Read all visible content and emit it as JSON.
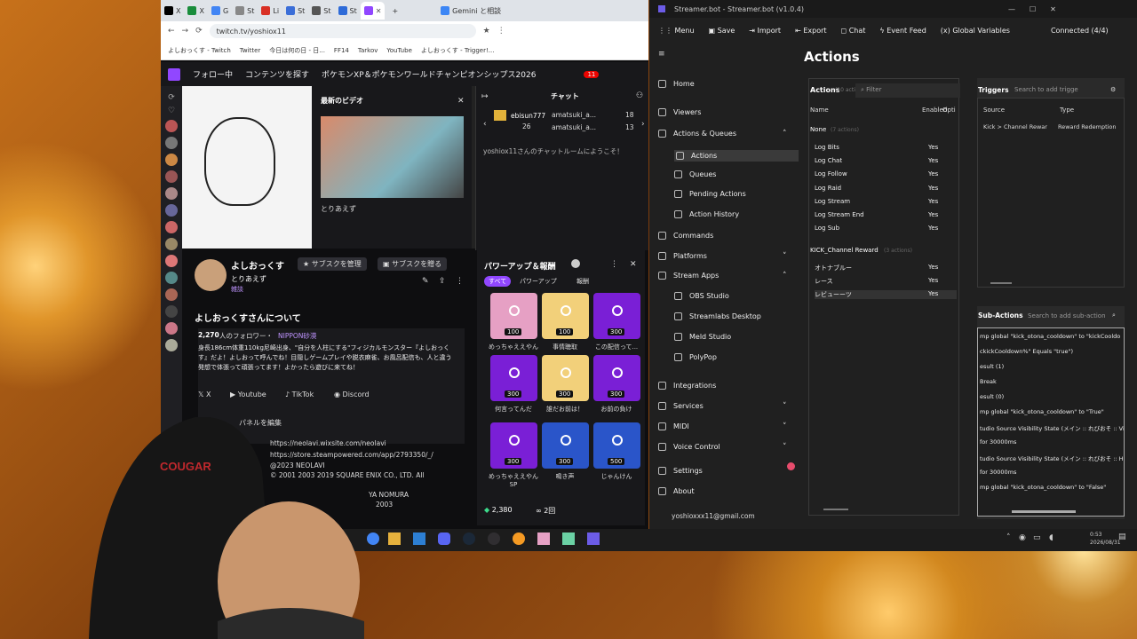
{
  "browser": {
    "tabs": [
      "X",
      "X",
      "G",
      "St",
      "Li",
      "St",
      "St",
      "St",
      "Gemini と相談"
    ],
    "url": "twitch.tv/yoshiox11",
    "bookmarks": [
      "よしおっくす - Twitch",
      "Twitter",
      "今日は何の日 - 日...",
      "FF14",
      "Tarkov",
      "YouTube",
      "よしおっくす - Trigger!..."
    ],
    "twitch_nav": {
      "following": "フォロー中",
      "browse": "コンテンツを探す",
      "stream_title": "ポケモンXP＆ポケモンワールドチャンピオンシップス2026",
      "notif_count": "11"
    }
  },
  "player": {
    "latest_title": "最新のビデオ",
    "latest_caption": "とりあえず"
  },
  "channel": {
    "name": "よしおっくす",
    "subscribe_manage": "サブスクを管理",
    "gift_sub": "サブスクを贈る",
    "category": "とりあえず",
    "tag": "雑談",
    "about_title": "よしおっくすさんについて",
    "followers_count": "2,270",
    "followers_label": "人のフォロワー・",
    "team": "NIPPON砂漠",
    "bio": "身長186cm体重110kg尼崎出身、\"自分を人柱にする\"フィジカルモンスター『よしおっくす』だよ！よしおって呼んでね！目隠しゲームプレイや脱衣麻雀、お風呂配信も、人と違う発想で体張って頑張ってます！よかったら遊びに来てね！",
    "socials": [
      "X",
      "Youtube",
      "TikTok",
      "Discord"
    ],
    "edit_panel": "パネルを編集",
    "links": [
      "https://neolavi.wixsite.com/neolavi",
      "https://store.steampowered.com/app/2793350/_/",
      "@2023 NEOLAVI",
      "© 2001 2003 2019 SQUARE ENIX CO., LTD. All",
      "YA NOMURA",
      "2003"
    ]
  },
  "powerups": {
    "title": "パワーアップ＆報酬",
    "tabs": [
      "すべて",
      "パワーアップ",
      "報酬"
    ],
    "rewards": [
      {
        "cost": "100",
        "label": "めっちゃええやん"
      },
      {
        "cost": "100",
        "label": "事情聴取"
      },
      {
        "cost": "300",
        "label": "この配信って..."
      },
      {
        "cost": "300",
        "label": "何言ってんだ"
      },
      {
        "cost": "300",
        "label": "誰だお前は！"
      },
      {
        "cost": "300",
        "label": "お前の負け"
      },
      {
        "cost": "300",
        "label": "めっちゃええやんSP"
      },
      {
        "cost": "300",
        "label": "鳴き声"
      },
      {
        "cost": "500",
        "label": "じゃんけん"
      }
    ],
    "points": "2,380",
    "streak": "2回"
  },
  "chat": {
    "title": "チャット",
    "gifters": [
      {
        "name": "ebisun777",
        "count": "26"
      },
      {
        "name": "amatsuki_a...",
        "count": "18"
      },
      {
        "name": "amatsuki_a...",
        "count": "13"
      }
    ],
    "welcome": "yoshiox11さんのチャットルームにようこそ！"
  },
  "streamerbot": {
    "title": "Streamer.bot - Streamer.bot (v1.0.4)",
    "menu": [
      "Menu",
      "Save",
      "Import",
      "Export",
      "Chat",
      "Event Feed",
      "Global Variables"
    ],
    "status": "Connected (4/4)",
    "nav": [
      "Home",
      "Viewers",
      "Actions & Queues",
      "Actions",
      "Queues",
      "Pending Actions",
      "Action History",
      "Commands",
      "Platforms",
      "Stream Apps",
      "OBS Studio",
      "Streamlabs Desktop",
      "Meld Studio",
      "PolyPop",
      "Integrations",
      "Services",
      "MIDI",
      "Voice Control",
      "Settings",
      "About"
    ],
    "account": "yoshioxxx11@gmail.com",
    "page_title": "Actions",
    "actions_header": "Actions",
    "actions_count": "(10 actions)",
    "filter_placeholder": "Filter",
    "columns": [
      "Name",
      "Enabled",
      "Opti"
    ],
    "group_none": "None",
    "group_none_count": "(7 actions)",
    "group_kick": "KICK_Channel Reward",
    "group_kick_count": "(3 actions)",
    "actions": [
      {
        "name": "Log Bits",
        "enabled": "Yes"
      },
      {
        "name": "Log Chat",
        "enabled": "Yes"
      },
      {
        "name": "Log Follow",
        "enabled": "Yes"
      },
      {
        "name": "Log Raid",
        "enabled": "Yes"
      },
      {
        "name": "Log Stream",
        "enabled": "Yes"
      },
      {
        "name": "Log Stream End",
        "enabled": "Yes"
      },
      {
        "name": "Log Sub",
        "enabled": "Yes"
      }
    ],
    "kick_actions": [
      {
        "name": "オトナブルー",
        "enabled": "Yes"
      },
      {
        "name": "レース",
        "enabled": "Yes"
      },
      {
        "name": "レビューーツ",
        "enabled": "Yes"
      }
    ],
    "triggers": {
      "header": "Triggers",
      "search": "Search to add trigge",
      "source_col": "Source",
      "type_col": "Type",
      "row_source": "Kick > Channel Rewar",
      "row_type": "Reward Redemption"
    },
    "subactions": {
      "header": "Sub-Actions",
      "search": "Search to add sub-action",
      "lines": [
        "mp global \"kick_otona_cooldown\" to \"kickCooldo",
        "ckickCooldown%\" Equals \"true\")",
        "esult (1)",
        "Break",
        "esult (0)",
        "mp global \"kick_otona_cooldown\" to \"True\"",
        "tudio Source Visibility State (メイン :: れびおそ :: Visit",
        "for 30000ms",
        "tudio Source Visibility State (メイン :: れびおそ :: Hidd",
        "for 30000ms",
        "mp global \"kick_otona_cooldown\" to \"False\""
      ]
    }
  },
  "taskbar": {
    "time": "0:53",
    "date": "2026/08/31"
  }
}
